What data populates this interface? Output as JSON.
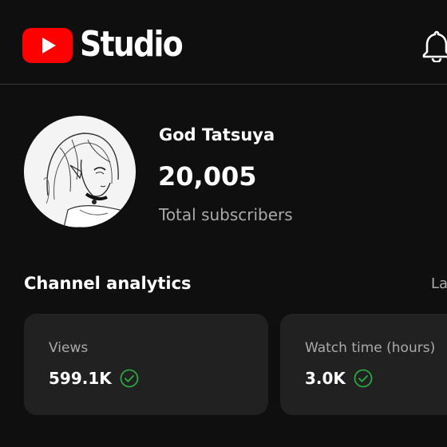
{
  "header": {
    "logo_text": "Studio"
  },
  "channel": {
    "name": "God Tatsuya",
    "subscriber_count": "20,005",
    "subscriber_label": "Total subscribers"
  },
  "analytics": {
    "title": "Channel analytics",
    "link_label": "La",
    "cards": [
      {
        "label": "Views",
        "value": "599.1K"
      },
      {
        "label": "Watch time (hours)",
        "value": "3.0K"
      }
    ]
  },
  "colors": {
    "background": "#0f0f0f",
    "card": "#212121",
    "brand_red": "#ff0000",
    "check_green": "#2ba640",
    "muted_text": "#aaaaaa"
  },
  "icons": {
    "logo": "youtube-play-icon",
    "notifications": "bell-icon",
    "status": "check-circle-icon"
  }
}
